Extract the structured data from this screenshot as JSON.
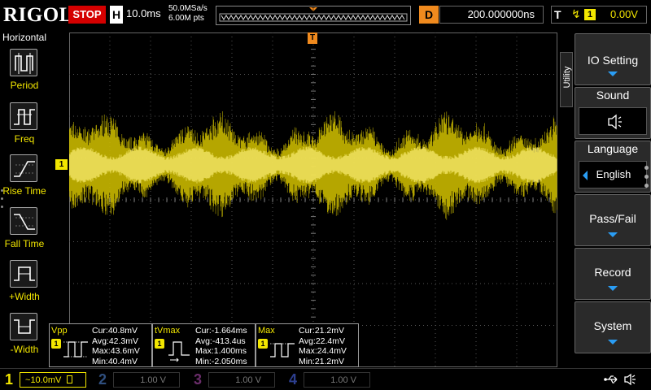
{
  "topbar": {
    "brand": "RIGOL",
    "run_state": "STOP",
    "timebase_label": "H",
    "timebase_value": "10.0ms",
    "sample_rate": "50.0MSa/s",
    "memory_depth": "6.00M pts",
    "delay_label": "D",
    "delay_value": "200.000000ns",
    "trigger_label": "T",
    "trigger_source": "1",
    "trigger_level": "0.00V"
  },
  "left_menu": {
    "title": "Horizontal",
    "items": [
      {
        "label": "Period",
        "icon": "period-icon"
      },
      {
        "label": "Freq",
        "icon": "freq-icon"
      },
      {
        "label": "Rise Time",
        "icon": "rise-time-icon"
      },
      {
        "label": "Fall Time",
        "icon": "fall-time-icon"
      },
      {
        "label": "+Width",
        "icon": "pos-width-icon"
      },
      {
        "label": "-Width",
        "icon": "neg-width-icon"
      }
    ]
  },
  "markers": {
    "ch1": "1",
    "trigger_position": "T",
    "trigger_level": "T"
  },
  "measurements": [
    {
      "name": "Vpp",
      "channel": "1",
      "cur": "Cur:40.8mV",
      "avg": "Avg:42.3mV",
      "max": "Max:43.6mV",
      "min": "Min:40.4mV"
    },
    {
      "name": "tVmax",
      "channel": "1",
      "cur": "Cur:-1.664ms",
      "avg": "Avg:-413.4us",
      "max": "Max:1.400ms",
      "min": "Min:-2.050ms"
    },
    {
      "name": "Max",
      "channel": "1",
      "cur": "Cur:21.2mV",
      "avg": "Avg:22.4mV",
      "max": "Max:24.4mV",
      "min": "Min:21.2mV"
    }
  ],
  "right_menu": {
    "tab": "Utility",
    "buttons": [
      {
        "label": "IO Setting"
      },
      {
        "label": "Sound",
        "value_icon": "speaker-icon"
      },
      {
        "label": "Language",
        "value": "English"
      },
      {
        "label": "Pass/Fail"
      },
      {
        "label": "Record"
      },
      {
        "label": "System"
      }
    ]
  },
  "channels": [
    {
      "num": "1",
      "coupling": "~",
      "scale": "10.0mV",
      "color": "#f2e600"
    },
    {
      "num": "2",
      "scale": "1.00 V",
      "color": "#2f4f7f"
    },
    {
      "num": "3",
      "scale": "1.00 V",
      "color": "#6a2d6a"
    },
    {
      "num": "4",
      "scale": "1.00 V",
      "color": "#2d3f8f"
    }
  ],
  "colors": {
    "ch1": "#f2e600",
    "trigger": "#f08a1e",
    "stop": "#d40000",
    "accent": "#2a9df4"
  }
}
